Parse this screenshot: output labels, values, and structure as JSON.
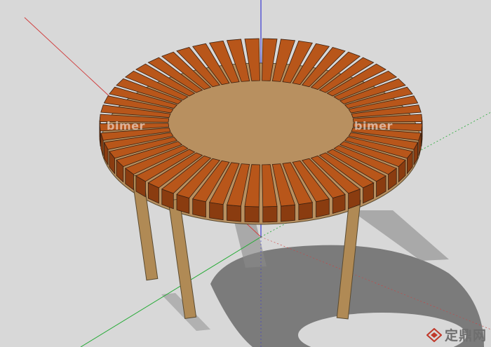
{
  "scene": {
    "background_color": "#d8d8d8",
    "object": "round-wooden-pergola-bench",
    "slat_color": "#b8561a",
    "post_color": "#b08a55",
    "shadow_color": "#7a7a7a"
  },
  "axes": {
    "red": "#d04040",
    "green": "#22aa33",
    "blue": "#3a3ad0"
  },
  "watermarks": {
    "left": "bimer",
    "right": "bimer"
  },
  "logo": {
    "text": "定鼎网",
    "icon": "diamond-logo-icon"
  }
}
